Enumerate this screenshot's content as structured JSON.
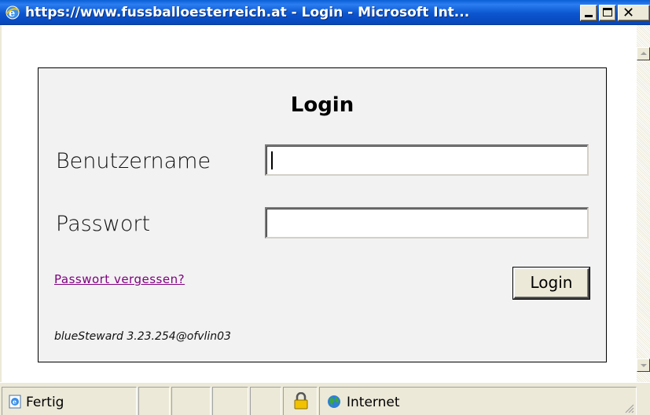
{
  "window": {
    "title": "https://www.fussballoesterreich.at - Login - Microsoft Int...",
    "icon": "ie-icon",
    "buttons": {
      "minimize": "minimize",
      "maximize": "maximize",
      "close": "close"
    }
  },
  "login_panel": {
    "heading": "Login",
    "username_label": "Benutzername",
    "username_value": "",
    "password_label": "Passwort",
    "password_value": "",
    "forgot_link": "Passwort vergessen?",
    "login_button": "Login",
    "version": "blueSteward 3.23.254@ofvlin03"
  },
  "statusbar": {
    "status_text": "Fertig",
    "zone_text": "Internet",
    "icons": [
      "ie-page-icon",
      "lock-icon",
      "globe-icon"
    ]
  },
  "colors": {
    "titlebar": "#0b56d0",
    "link_visited": "#800080",
    "panel_bg": "#f2f2f2",
    "chrome": "#ece9d8"
  }
}
